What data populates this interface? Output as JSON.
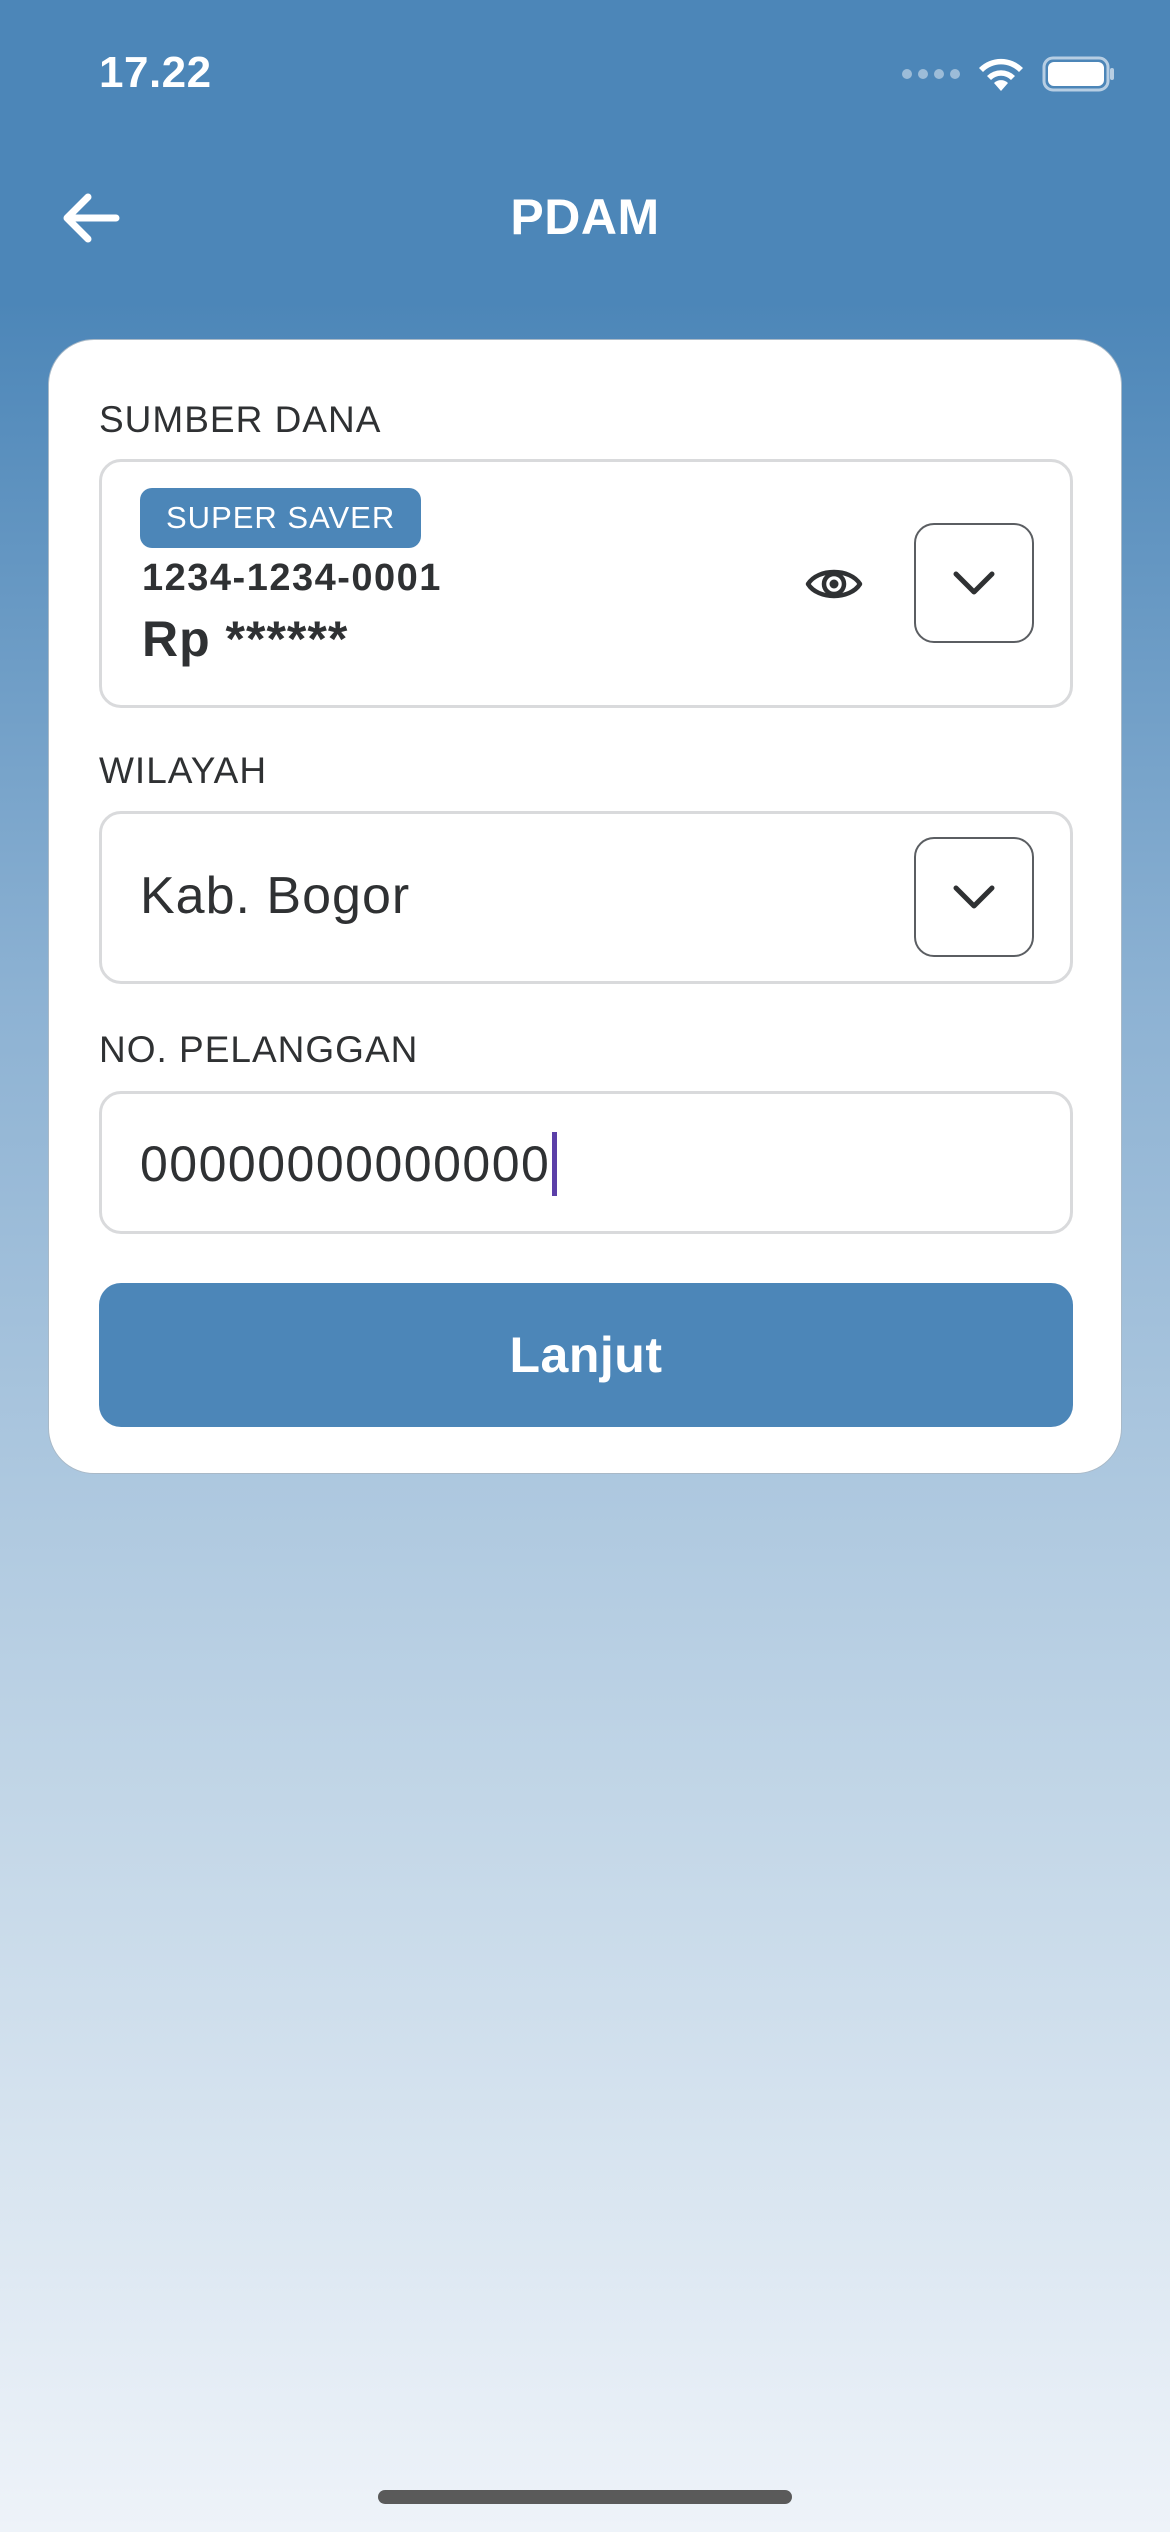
{
  "status_bar": {
    "time": "17.22"
  },
  "header": {
    "title": "PDAM"
  },
  "form": {
    "source_of_funds": {
      "label": "SUMBER DANA",
      "badge": "SUPER SAVER",
      "account_number": "1234-1234-0001",
      "balance": "Rp ******"
    },
    "region": {
      "label": "WILAYAH",
      "value": "Kab. Bogor"
    },
    "customer_number": {
      "label": "NO. PELANGGAN",
      "value": "00000000000000"
    },
    "submit_label": "Lanjut"
  },
  "icons": {
    "back": "arrow-left-icon",
    "visibility": "eye-icon",
    "dropdown": "chevron-down-icon",
    "wifi": "wifi-icon",
    "battery": "battery-icon"
  },
  "colors": {
    "primary": "#4c86b8",
    "text": "#2f3133",
    "caret": "#5b3fa8"
  }
}
